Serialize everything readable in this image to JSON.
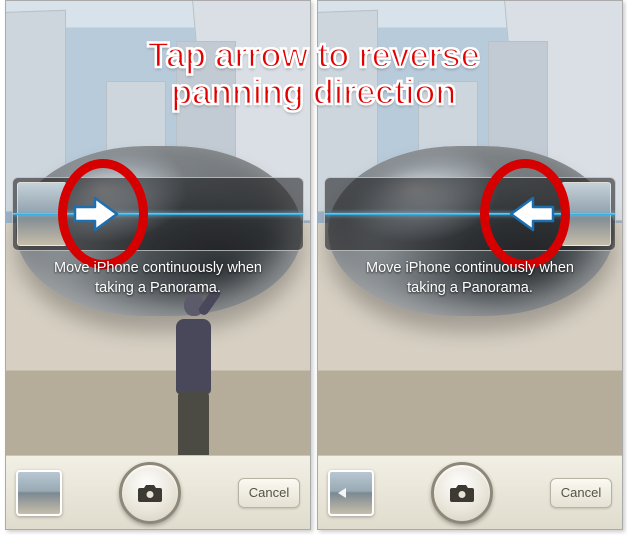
{
  "annotation": {
    "text": "Tap arrow to reverse\npanning direction"
  },
  "left_screen": {
    "instruction": "Move iPhone continuously when\ntaking a Panorama.",
    "arrow_direction": "right",
    "cancel_label": "Cancel"
  },
  "right_screen": {
    "instruction": "Move iPhone continuously when\ntaking a Panorama.",
    "arrow_direction": "left",
    "cancel_label": "Cancel"
  },
  "icons": {
    "pano_arrow": "panorama-direction-arrow-icon",
    "shutter": "camera-icon"
  },
  "colors": {
    "highlight": "#d60000",
    "annotation_text": "#e30000",
    "centerline": "#6fd5ff"
  }
}
